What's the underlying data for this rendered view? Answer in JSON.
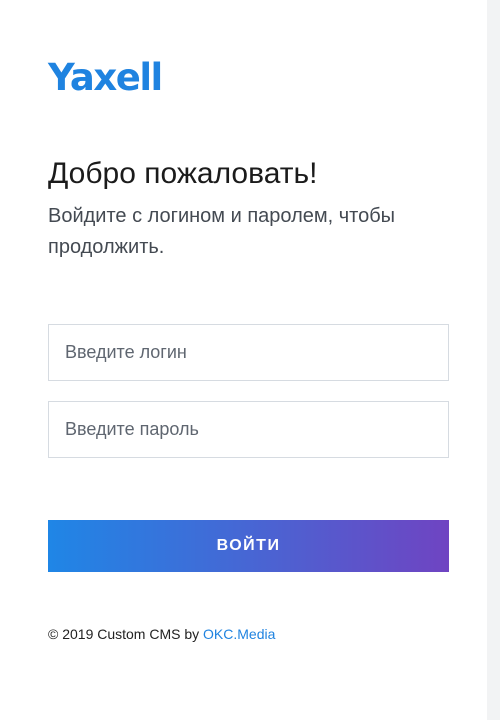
{
  "brand": {
    "logo_text": "Yaxell",
    "accent_color": "#1f83e0"
  },
  "welcome": {
    "title": "Добро пожаловать!",
    "subtitle": "Войдите с логином и паролем, чтобы продолжить."
  },
  "form": {
    "login_placeholder": "Введите логин",
    "password_placeholder": "Введите пароль",
    "submit_label": "ВОЙТИ",
    "submit_gradient": [
      "#1f86e6",
      "#6f44c2"
    ]
  },
  "footer": {
    "copyright_text": "© 2019 Custom CMS by",
    "link_text": "OKC.Media"
  }
}
